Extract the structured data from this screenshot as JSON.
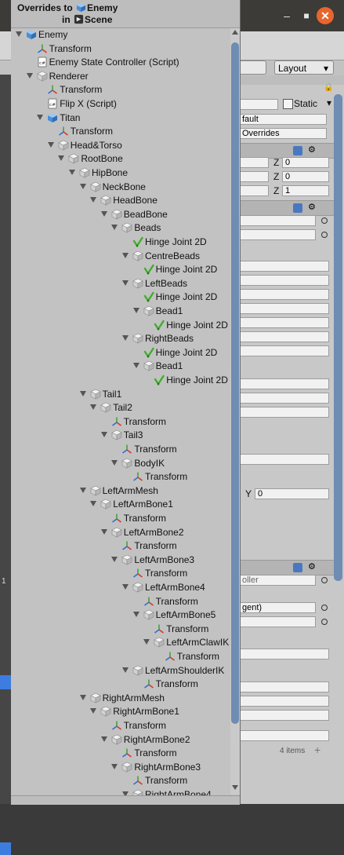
{
  "popup": {
    "title_prefix": "Overrides to",
    "target_name": "Enemy",
    "scope_prefix": "in",
    "scope_name": "Scene"
  },
  "window_controls": {
    "minimize": "–",
    "maximize": "■",
    "close": "✕"
  },
  "toolbar": {
    "layout_label": "Layout"
  },
  "inspector": {
    "static_label": "Static",
    "tag_value": "fault",
    "layer_value": "Overrides",
    "z_label": "Z",
    "pos_z": "0",
    "rot_z": "0",
    "scale_z": "1",
    "y_label": "Y",
    "y_value": "0",
    "controller_placeholder": "oller",
    "agent_value": "gent)",
    "items_count": "4 items",
    "left_value": "1"
  },
  "tree": [
    {
      "depth": 0,
      "fold": true,
      "icon": "gameobject-blue-icon",
      "label": "Enemy"
    },
    {
      "depth": 1,
      "fold": false,
      "icon": "transform-icon",
      "label": "Transform"
    },
    {
      "depth": 1,
      "fold": false,
      "icon": "script-icon",
      "label": "Enemy State Controller (Script)"
    },
    {
      "depth": 1,
      "fold": true,
      "icon": "gameobject-grey-icon",
      "label": "Renderer"
    },
    {
      "depth": 2,
      "fold": false,
      "icon": "transform-icon",
      "label": "Transform"
    },
    {
      "depth": 2,
      "fold": false,
      "icon": "script-icon",
      "label": "Flip X (Script)"
    },
    {
      "depth": 2,
      "fold": true,
      "icon": "gameobject-blue-icon",
      "label": "Titan"
    },
    {
      "depth": 3,
      "fold": false,
      "icon": "transform-icon",
      "label": "Transform"
    },
    {
      "depth": 3,
      "fold": true,
      "icon": "gameobject-grey-icon",
      "label": "Head&Torso"
    },
    {
      "depth": 4,
      "fold": true,
      "icon": "gameobject-grey-icon",
      "label": "RootBone"
    },
    {
      "depth": 5,
      "fold": true,
      "icon": "gameobject-grey-icon",
      "label": "HipBone"
    },
    {
      "depth": 6,
      "fold": true,
      "icon": "gameobject-grey-icon",
      "label": "NeckBone"
    },
    {
      "depth": 7,
      "fold": true,
      "icon": "gameobject-grey-icon",
      "label": "HeadBone"
    },
    {
      "depth": 8,
      "fold": true,
      "icon": "gameobject-grey-icon",
      "label": "BeadBone"
    },
    {
      "depth": 9,
      "fold": true,
      "icon": "gameobject-grey-icon",
      "label": "Beads"
    },
    {
      "depth": 10,
      "fold": false,
      "icon": "hinge-joint-icon",
      "label": "Hinge Joint 2D"
    },
    {
      "depth": 10,
      "fold": true,
      "icon": "gameobject-grey-icon",
      "label": "CentreBeads"
    },
    {
      "depth": 11,
      "fold": false,
      "icon": "hinge-joint-icon",
      "label": "Hinge Joint 2D"
    },
    {
      "depth": 10,
      "fold": true,
      "icon": "gameobject-grey-icon",
      "label": "LeftBeads"
    },
    {
      "depth": 11,
      "fold": false,
      "icon": "hinge-joint-icon",
      "label": "Hinge Joint 2D"
    },
    {
      "depth": 11,
      "fold": true,
      "icon": "gameobject-grey-icon",
      "label": "Bead1"
    },
    {
      "depth": 12,
      "fold": false,
      "icon": "hinge-joint-icon",
      "label": "Hinge Joint 2D"
    },
    {
      "depth": 10,
      "fold": true,
      "icon": "gameobject-grey-icon",
      "label": "RightBeads"
    },
    {
      "depth": 11,
      "fold": false,
      "icon": "hinge-joint-icon",
      "label": "Hinge Joint 2D"
    },
    {
      "depth": 11,
      "fold": true,
      "icon": "gameobject-grey-icon",
      "label": "Bead1"
    },
    {
      "depth": 12,
      "fold": false,
      "icon": "hinge-joint-icon",
      "label": "Hinge Joint 2D"
    },
    {
      "depth": 6,
      "fold": true,
      "icon": "gameobject-grey-icon",
      "label": "Tail1"
    },
    {
      "depth": 7,
      "fold": true,
      "icon": "gameobject-grey-icon",
      "label": "Tail2"
    },
    {
      "depth": 8,
      "fold": false,
      "icon": "transform-icon",
      "label": "Transform"
    },
    {
      "depth": 8,
      "fold": true,
      "icon": "gameobject-grey-icon",
      "label": "Tail3"
    },
    {
      "depth": 9,
      "fold": false,
      "icon": "transform-icon",
      "label": "Transform"
    },
    {
      "depth": 9,
      "fold": true,
      "icon": "gameobject-grey-icon",
      "label": "BodyIK"
    },
    {
      "depth": 10,
      "fold": false,
      "icon": "transform-icon",
      "label": "Transform"
    },
    {
      "depth": 6,
      "fold": true,
      "icon": "gameobject-grey-icon",
      "label": "LeftArmMesh"
    },
    {
      "depth": 7,
      "fold": true,
      "icon": "gameobject-grey-icon",
      "label": "LeftArmBone1"
    },
    {
      "depth": 8,
      "fold": false,
      "icon": "transform-icon",
      "label": "Transform"
    },
    {
      "depth": 8,
      "fold": true,
      "icon": "gameobject-grey-icon",
      "label": "LeftArmBone2"
    },
    {
      "depth": 9,
      "fold": false,
      "icon": "transform-icon",
      "label": "Transform"
    },
    {
      "depth": 9,
      "fold": true,
      "icon": "gameobject-grey-icon",
      "label": "LeftArmBone3"
    },
    {
      "depth": 10,
      "fold": false,
      "icon": "transform-icon",
      "label": "Transform"
    },
    {
      "depth": 10,
      "fold": true,
      "icon": "gameobject-grey-icon",
      "label": "LeftArmBone4"
    },
    {
      "depth": 11,
      "fold": false,
      "icon": "transform-icon",
      "label": "Transform"
    },
    {
      "depth": 11,
      "fold": true,
      "icon": "gameobject-grey-icon",
      "label": "LeftArmBone5"
    },
    {
      "depth": 12,
      "fold": false,
      "icon": "transform-icon",
      "label": "Transform"
    },
    {
      "depth": 12,
      "fold": true,
      "icon": "gameobject-grey-icon",
      "label": "LeftArmClawIK"
    },
    {
      "depth": 13,
      "fold": false,
      "icon": "transform-icon",
      "label": "Transform"
    },
    {
      "depth": 10,
      "fold": true,
      "icon": "gameobject-grey-icon",
      "label": "LeftArmShoulderIK"
    },
    {
      "depth": 11,
      "fold": false,
      "icon": "transform-icon",
      "label": "Transform"
    },
    {
      "depth": 6,
      "fold": true,
      "icon": "gameobject-grey-icon",
      "label": "RightArmMesh"
    },
    {
      "depth": 7,
      "fold": true,
      "icon": "gameobject-grey-icon",
      "label": "RightArmBone1"
    },
    {
      "depth": 8,
      "fold": false,
      "icon": "transform-icon",
      "label": "Transform"
    },
    {
      "depth": 8,
      "fold": true,
      "icon": "gameobject-grey-icon",
      "label": "RightArmBone2"
    },
    {
      "depth": 9,
      "fold": false,
      "icon": "transform-icon",
      "label": "Transform"
    },
    {
      "depth": 9,
      "fold": true,
      "icon": "gameobject-grey-icon",
      "label": "RightArmBone3"
    },
    {
      "depth": 10,
      "fold": false,
      "icon": "transform-icon",
      "label": "Transform"
    },
    {
      "depth": 10,
      "fold": true,
      "icon": "gameobject-grey-icon",
      "label": "RightArmBone4"
    }
  ],
  "colors": {
    "selection_blue": "#3e7de0",
    "scroll_thumb": "#6f8cb2",
    "close_orange": "#e8662d",
    "hinge_green": "#3fae2a"
  }
}
